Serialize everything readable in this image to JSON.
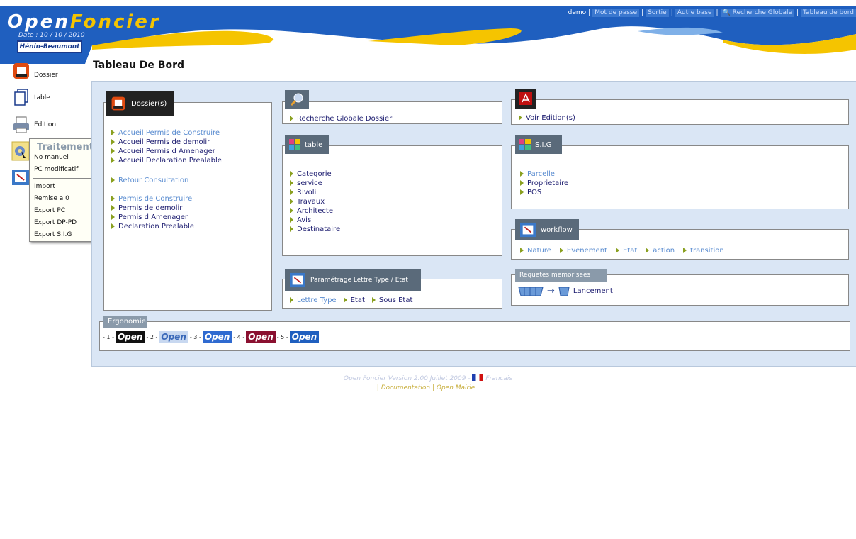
{
  "app": {
    "logo_part1": "Open",
    "logo_part2": "Foncier",
    "date": "Date : 10 / 10 / 2010",
    "city": "Hénin-Beaumont"
  },
  "topmenu": {
    "user": "demo",
    "items": [
      "Mot de passe",
      "Sortie",
      "Autre base",
      "Recherche Globale",
      "Tableau de bord"
    ]
  },
  "page_title": "Tableau De Bord",
  "nav": {
    "items": [
      {
        "label": "Dossier",
        "icon": "dossier-icon"
      },
      {
        "label": "table",
        "icon": "table-icon"
      },
      {
        "label": "Edition",
        "icon": "printer-icon"
      }
    ]
  },
  "popup": {
    "title": "Traitement",
    "items": [
      "No manuel",
      "PC modificatif",
      "Import",
      "Remise a 0",
      "Export PC",
      "Export DP-PD",
      "Export S.I.G"
    ]
  },
  "dossiers": {
    "tab": "Dossier(s)",
    "links": [
      "Accueil Permis de Construire",
      "Accueil Permis de demolir",
      "Accueil Permis d Amenager",
      "Accueil Declaration Prealable",
      "Retour Consultation",
      "Permis de Construire",
      "Permis de demolir",
      "Permis d Amenager",
      "Declaration Prealable"
    ]
  },
  "recherche": {
    "link": "Recherche Globale Dossier"
  },
  "table": {
    "tab": "table",
    "links": [
      "Categorie",
      "service",
      "Rivoli",
      "Travaux",
      "Architecte",
      "Avis",
      "Destinataire"
    ]
  },
  "parametrage": {
    "tab": "Paramétrage Lettre Type / Etat",
    "links": [
      "Lettre Type",
      "Etat",
      "Sous Etat"
    ]
  },
  "edition": {
    "link": "Voir  Edition(s)"
  },
  "sig": {
    "tab": "S.I.G",
    "links": [
      "Parcelle",
      "Proprietaire",
      "POS"
    ]
  },
  "workflow": {
    "tab": "workflow",
    "links": [
      "Nature",
      "Evenement",
      "Etat",
      "action",
      "transition"
    ]
  },
  "requetes": {
    "tab": "Requetes memorisees",
    "link": "Lancement"
  },
  "ergonomie": {
    "tab": "Ergonomie",
    "nums": [
      "- 1 -",
      "- 2 -",
      "- 3 -",
      "- 4 -",
      "- 5 -"
    ],
    "label": "Open"
  },
  "footer": {
    "line1": "Open Foncier  Version 2.00 Juillet 2009 - ",
    "lang": "Francais",
    "doc": "Documentation",
    "mairie": "Open Mairie"
  },
  "colors": {
    "header_blue": "#1f5fbf",
    "accent_yellow": "#f5c400",
    "panel_bg": "#dae6f5"
  }
}
